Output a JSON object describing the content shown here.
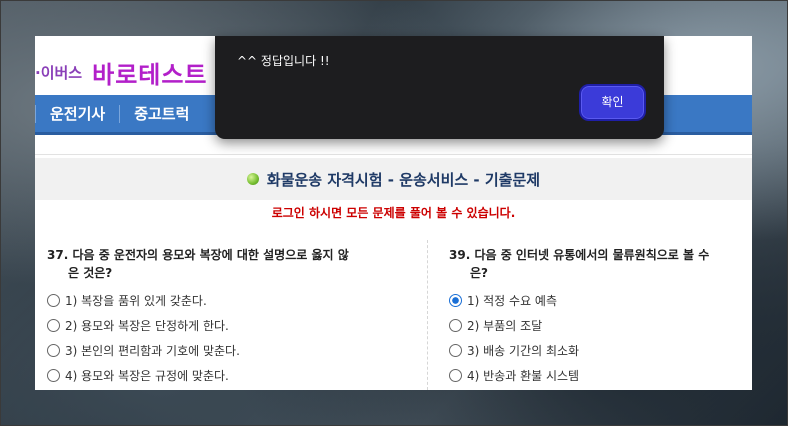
{
  "header": {
    "logo_small": "·이버스",
    "logo_big": "바로테스트"
  },
  "nav": {
    "items": [
      {
        "label": "운전기사"
      },
      {
        "label": "중고트럭"
      }
    ]
  },
  "section": {
    "title": "화물운송 자격시험 - 운송서비스 - 기출문제",
    "login_notice": "로그인 하시면 모든 문제를 풀어 볼 수 있습니다."
  },
  "questions": [
    {
      "number": "37.",
      "text_line1": "다음 중 운전자의 용모와 복장에 대한 설명으로 옳지 않",
      "text_line2": "은 것은?",
      "options": [
        {
          "label": "1) 복장을 품위 있게 갖춘다.",
          "checked": false
        },
        {
          "label": "2) 용모와 복장은 단정하게 한다.",
          "checked": false
        },
        {
          "label": "3) 본인의 편리함과 기호에 맞춘다.",
          "checked": false
        },
        {
          "label": "4) 용모와 복장은 규정에 맞춘다.",
          "checked": false
        }
      ]
    },
    {
      "number": "39.",
      "text_line1": "다음 중 인터넷 유통에서의 물류원칙으로 볼 수",
      "text_line2": "은?",
      "options": [
        {
          "label": "1) 적정 수요 예측",
          "checked": true
        },
        {
          "label": "2) 부품의 조달",
          "checked": false
        },
        {
          "label": "3) 배송 기간의 최소화",
          "checked": false
        },
        {
          "label": "4) 반송과 환불 시스템",
          "checked": false
        }
      ]
    }
  ],
  "modal": {
    "message": "^^ 정답입니다 !!",
    "confirm_label": "확인"
  },
  "colors": {
    "nav_bg": "#3a78c4",
    "notice_red": "#cc0000",
    "modal_bg": "#1d1d1f",
    "modal_button": "#3b3bd9"
  }
}
